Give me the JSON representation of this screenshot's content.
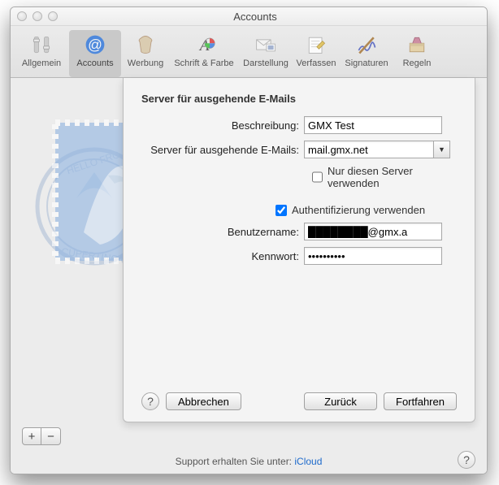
{
  "window": {
    "title": "Accounts"
  },
  "toolbar": {
    "items": [
      {
        "label": "Allgemein"
      },
      {
        "label": "Accounts"
      },
      {
        "label": "Werbung"
      },
      {
        "label": "Schrift & Farbe"
      },
      {
        "label": "Darstellung"
      },
      {
        "label": "Verfassen"
      },
      {
        "label": "Signaturen"
      },
      {
        "label": "Regeln"
      }
    ]
  },
  "sheet": {
    "heading": "Server für ausgehende E-Mails",
    "labels": {
      "description": "Beschreibung:",
      "server": "Server für ausgehende E-Mails:",
      "only_this": "Nur diesen Server verwenden",
      "use_auth": "Authentifizierung verwenden",
      "username": "Benutzername:",
      "password": "Kennwort:"
    },
    "values": {
      "description": "GMX Test",
      "server": "mail.gmx.net",
      "only_this": false,
      "use_auth": true,
      "username_suffix": "@gmx.a",
      "password": "••••••••••"
    },
    "buttons": {
      "cancel": "Abbrechen",
      "back": "Zurück",
      "continue": "Fortfahren"
    }
  },
  "footer": {
    "support_prefix": "Support erhalten Sie unter: ",
    "support_link": "iCloud"
  },
  "tooltips": {
    "help": "?"
  }
}
